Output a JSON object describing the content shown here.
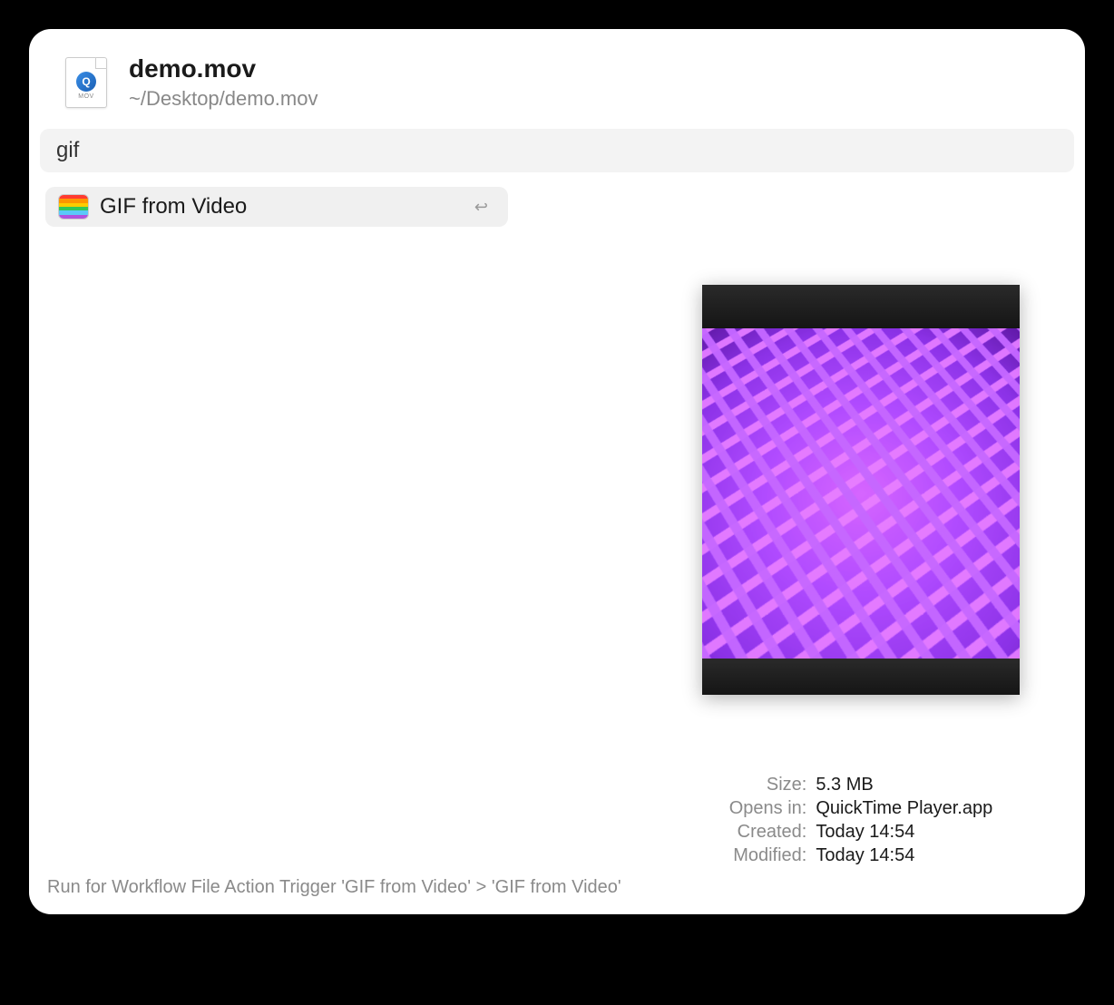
{
  "header": {
    "filename": "demo.mov",
    "filepath": "~/Desktop/demo.mov",
    "file_ext_badge": "MOV"
  },
  "search": {
    "query": "gif"
  },
  "results": [
    {
      "label": "GIF from Video",
      "icon": "rainbow-stripes-icon"
    }
  ],
  "metadata": {
    "size_label": "Size:",
    "size_value": "5.3 MB",
    "opens_label": "Opens in:",
    "opens_value": "QuickTime Player.app",
    "created_label": "Created:",
    "created_value": "Today 14:54",
    "modified_label": "Modified:",
    "modified_value": "Today 14:54"
  },
  "footer": {
    "hint": "Run for Workflow File Action Trigger 'GIF from Video' > 'GIF from Video'"
  }
}
